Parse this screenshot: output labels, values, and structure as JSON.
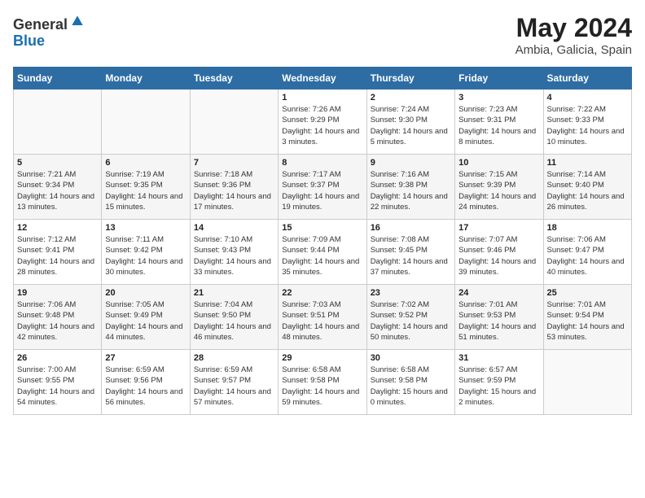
{
  "header": {
    "logo_general": "General",
    "logo_blue": "Blue",
    "month_title": "May 2024",
    "location": "Ambia, Galicia, Spain"
  },
  "days_of_week": [
    "Sunday",
    "Monday",
    "Tuesday",
    "Wednesday",
    "Thursday",
    "Friday",
    "Saturday"
  ],
  "weeks": [
    [
      {
        "day": "",
        "sunrise": "",
        "sunset": "",
        "daylight": ""
      },
      {
        "day": "",
        "sunrise": "",
        "sunset": "",
        "daylight": ""
      },
      {
        "day": "",
        "sunrise": "",
        "sunset": "",
        "daylight": ""
      },
      {
        "day": "1",
        "sunrise": "Sunrise: 7:26 AM",
        "sunset": "Sunset: 9:29 PM",
        "daylight": "Daylight: 14 hours and 3 minutes."
      },
      {
        "day": "2",
        "sunrise": "Sunrise: 7:24 AM",
        "sunset": "Sunset: 9:30 PM",
        "daylight": "Daylight: 14 hours and 5 minutes."
      },
      {
        "day": "3",
        "sunrise": "Sunrise: 7:23 AM",
        "sunset": "Sunset: 9:31 PM",
        "daylight": "Daylight: 14 hours and 8 minutes."
      },
      {
        "day": "4",
        "sunrise": "Sunrise: 7:22 AM",
        "sunset": "Sunset: 9:33 PM",
        "daylight": "Daylight: 14 hours and 10 minutes."
      }
    ],
    [
      {
        "day": "5",
        "sunrise": "Sunrise: 7:21 AM",
        "sunset": "Sunset: 9:34 PM",
        "daylight": "Daylight: 14 hours and 13 minutes."
      },
      {
        "day": "6",
        "sunrise": "Sunrise: 7:19 AM",
        "sunset": "Sunset: 9:35 PM",
        "daylight": "Daylight: 14 hours and 15 minutes."
      },
      {
        "day": "7",
        "sunrise": "Sunrise: 7:18 AM",
        "sunset": "Sunset: 9:36 PM",
        "daylight": "Daylight: 14 hours and 17 minutes."
      },
      {
        "day": "8",
        "sunrise": "Sunrise: 7:17 AM",
        "sunset": "Sunset: 9:37 PM",
        "daylight": "Daylight: 14 hours and 19 minutes."
      },
      {
        "day": "9",
        "sunrise": "Sunrise: 7:16 AM",
        "sunset": "Sunset: 9:38 PM",
        "daylight": "Daylight: 14 hours and 22 minutes."
      },
      {
        "day": "10",
        "sunrise": "Sunrise: 7:15 AM",
        "sunset": "Sunset: 9:39 PM",
        "daylight": "Daylight: 14 hours and 24 minutes."
      },
      {
        "day": "11",
        "sunrise": "Sunrise: 7:14 AM",
        "sunset": "Sunset: 9:40 PM",
        "daylight": "Daylight: 14 hours and 26 minutes."
      }
    ],
    [
      {
        "day": "12",
        "sunrise": "Sunrise: 7:12 AM",
        "sunset": "Sunset: 9:41 PM",
        "daylight": "Daylight: 14 hours and 28 minutes."
      },
      {
        "day": "13",
        "sunrise": "Sunrise: 7:11 AM",
        "sunset": "Sunset: 9:42 PM",
        "daylight": "Daylight: 14 hours and 30 minutes."
      },
      {
        "day": "14",
        "sunrise": "Sunrise: 7:10 AM",
        "sunset": "Sunset: 9:43 PM",
        "daylight": "Daylight: 14 hours and 33 minutes."
      },
      {
        "day": "15",
        "sunrise": "Sunrise: 7:09 AM",
        "sunset": "Sunset: 9:44 PM",
        "daylight": "Daylight: 14 hours and 35 minutes."
      },
      {
        "day": "16",
        "sunrise": "Sunrise: 7:08 AM",
        "sunset": "Sunset: 9:45 PM",
        "daylight": "Daylight: 14 hours and 37 minutes."
      },
      {
        "day": "17",
        "sunrise": "Sunrise: 7:07 AM",
        "sunset": "Sunset: 9:46 PM",
        "daylight": "Daylight: 14 hours and 39 minutes."
      },
      {
        "day": "18",
        "sunrise": "Sunrise: 7:06 AM",
        "sunset": "Sunset: 9:47 PM",
        "daylight": "Daylight: 14 hours and 40 minutes."
      }
    ],
    [
      {
        "day": "19",
        "sunrise": "Sunrise: 7:06 AM",
        "sunset": "Sunset: 9:48 PM",
        "daylight": "Daylight: 14 hours and 42 minutes."
      },
      {
        "day": "20",
        "sunrise": "Sunrise: 7:05 AM",
        "sunset": "Sunset: 9:49 PM",
        "daylight": "Daylight: 14 hours and 44 minutes."
      },
      {
        "day": "21",
        "sunrise": "Sunrise: 7:04 AM",
        "sunset": "Sunset: 9:50 PM",
        "daylight": "Daylight: 14 hours and 46 minutes."
      },
      {
        "day": "22",
        "sunrise": "Sunrise: 7:03 AM",
        "sunset": "Sunset: 9:51 PM",
        "daylight": "Daylight: 14 hours and 48 minutes."
      },
      {
        "day": "23",
        "sunrise": "Sunrise: 7:02 AM",
        "sunset": "Sunset: 9:52 PM",
        "daylight": "Daylight: 14 hours and 50 minutes."
      },
      {
        "day": "24",
        "sunrise": "Sunrise: 7:01 AM",
        "sunset": "Sunset: 9:53 PM",
        "daylight": "Daylight: 14 hours and 51 minutes."
      },
      {
        "day": "25",
        "sunrise": "Sunrise: 7:01 AM",
        "sunset": "Sunset: 9:54 PM",
        "daylight": "Daylight: 14 hours and 53 minutes."
      }
    ],
    [
      {
        "day": "26",
        "sunrise": "Sunrise: 7:00 AM",
        "sunset": "Sunset: 9:55 PM",
        "daylight": "Daylight: 14 hours and 54 minutes."
      },
      {
        "day": "27",
        "sunrise": "Sunrise: 6:59 AM",
        "sunset": "Sunset: 9:56 PM",
        "daylight": "Daylight: 14 hours and 56 minutes."
      },
      {
        "day": "28",
        "sunrise": "Sunrise: 6:59 AM",
        "sunset": "Sunset: 9:57 PM",
        "daylight": "Daylight: 14 hours and 57 minutes."
      },
      {
        "day": "29",
        "sunrise": "Sunrise: 6:58 AM",
        "sunset": "Sunset: 9:58 PM",
        "daylight": "Daylight: 14 hours and 59 minutes."
      },
      {
        "day": "30",
        "sunrise": "Sunrise: 6:58 AM",
        "sunset": "Sunset: 9:58 PM",
        "daylight": "Daylight: 15 hours and 0 minutes."
      },
      {
        "day": "31",
        "sunrise": "Sunrise: 6:57 AM",
        "sunset": "Sunset: 9:59 PM",
        "daylight": "Daylight: 15 hours and 2 minutes."
      },
      {
        "day": "",
        "sunrise": "",
        "sunset": "",
        "daylight": ""
      }
    ]
  ]
}
